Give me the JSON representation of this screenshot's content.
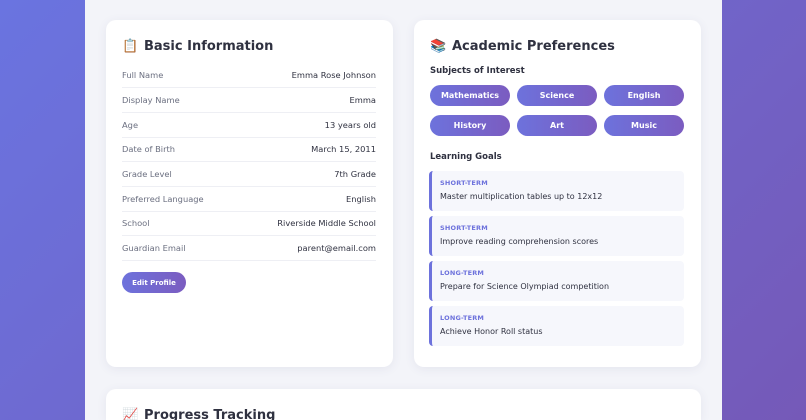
{
  "basic": {
    "icon": "clipboard-icon",
    "icon_glyph": "📋",
    "title": "Basic Information",
    "rows": [
      {
        "label": "Full Name",
        "value": "Emma Rose Johnson"
      },
      {
        "label": "Display Name",
        "value": "Emma"
      },
      {
        "label": "Age",
        "value": "13 years old"
      },
      {
        "label": "Date of Birth",
        "value": "March 15, 2011"
      },
      {
        "label": "Grade Level",
        "value": "7th Grade"
      },
      {
        "label": "Preferred Language",
        "value": "English"
      },
      {
        "label": "School",
        "value": "Riverside Middle School"
      },
      {
        "label": "Guardian Email",
        "value": "parent@email.com"
      }
    ],
    "edit_label": "Edit Profile"
  },
  "academic": {
    "icon": "books-icon",
    "icon_glyph": "📚",
    "title": "Academic Preferences",
    "subjects_heading": "Subjects of Interest",
    "subjects": [
      "Mathematics",
      "Science",
      "English",
      "History",
      "Art",
      "Music"
    ],
    "goals_heading": "Learning Goals",
    "goals": [
      {
        "term": "SHORT-TERM",
        "text": "Master multiplication tables up to 12x12"
      },
      {
        "term": "SHORT-TERM",
        "text": "Improve reading comprehension scores"
      },
      {
        "term": "LONG-TERM",
        "text": "Prepare for Science Olympiad competition"
      },
      {
        "term": "LONG-TERM",
        "text": "Achieve Honor Roll status"
      }
    ]
  },
  "progress": {
    "icon": "chart-increasing-icon",
    "icon_glyph": "📈",
    "title": "Progress Tracking"
  },
  "colors": {
    "accent": "#6d72dc",
    "accent_end": "#7b5cc0",
    "background": "#f3f4f9"
  }
}
